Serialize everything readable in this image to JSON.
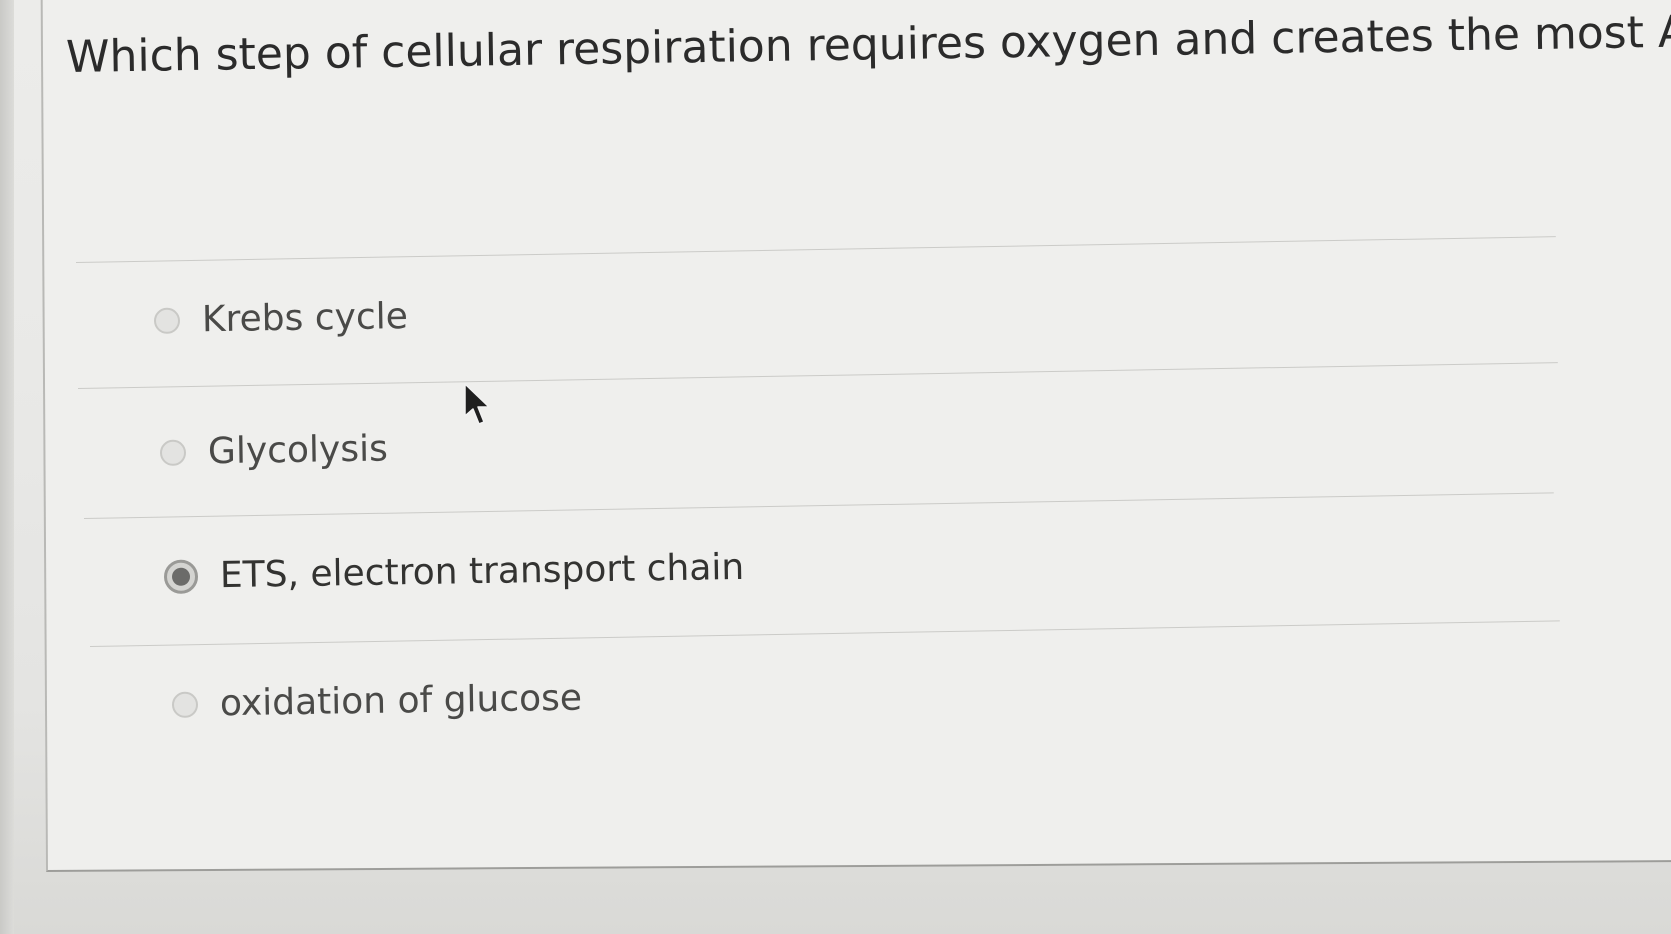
{
  "question": {
    "text": "Which step of cellular respiration requires oxygen and creates the most ATP?"
  },
  "options": [
    {
      "label": "Krebs cycle",
      "selected": false
    },
    {
      "label": "Glycolysis",
      "selected": false
    },
    {
      "label": "ETS, electron transport chain",
      "selected": true
    },
    {
      "label": "oxidation of glucose",
      "selected": false
    }
  ],
  "icons": {
    "cursor": "mouse-pointer-icon"
  }
}
